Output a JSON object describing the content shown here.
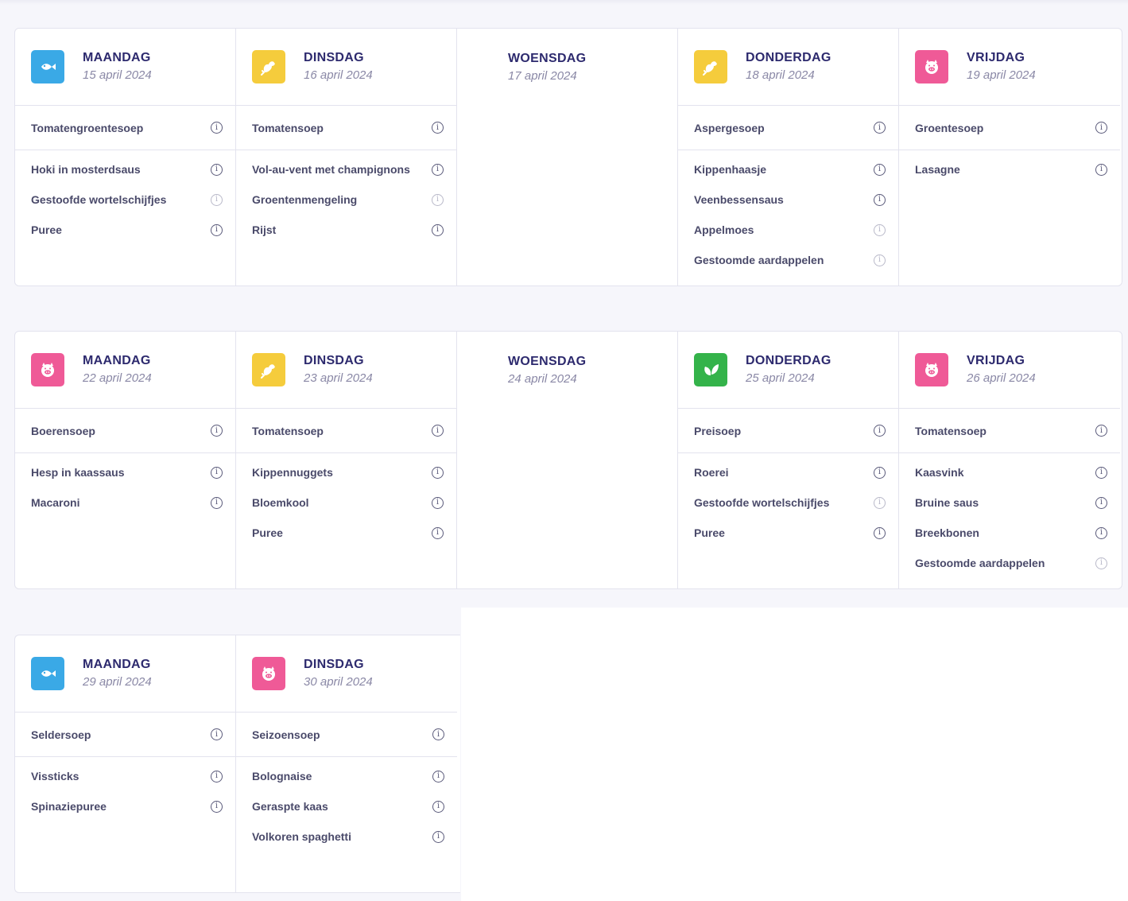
{
  "colors": {
    "fish": "#3aa9e6",
    "chicken": "#f5cc3c",
    "pork": "#ef5a97",
    "vegetarian": "#34b34a",
    "title": "#2d2a6e"
  },
  "weeks": [
    {
      "days": [
        {
          "name": "MAANDAG",
          "date": "15 april 2024",
          "icon": "fish-icon",
          "color": "#3aa9e6",
          "soup": "Tomatengroentesoep",
          "items": [
            "Hoki in mosterdsaus",
            "Gestoofde wortelschijfjes",
            "Puree"
          ]
        },
        {
          "name": "DINSDAG",
          "date": "16 april 2024",
          "icon": "chicken-icon",
          "color": "#f5cc3c",
          "soup": "Tomatensoep",
          "items": [
            "Vol-au-vent met champignons",
            "Groentenmengeling",
            "Rijst"
          ]
        },
        {
          "name": "WOENSDAG",
          "date": "17 april 2024",
          "icon": null,
          "color": null,
          "soup": null,
          "items": []
        },
        {
          "name": "DONDERDAG",
          "date": "18 april 2024",
          "icon": "chicken-icon",
          "color": "#f5cc3c",
          "soup": "Aspergesoep",
          "items": [
            "Kippenhaasje",
            "Veenbessensaus",
            "Appelmoes",
            "Gestoomde aardappelen"
          ]
        },
        {
          "name": "VRIJDAG",
          "date": "19 april 2024",
          "icon": "pig-icon",
          "color": "#ef5a97",
          "soup": "Groentesoep",
          "items": [
            "Lasagne"
          ]
        }
      ]
    },
    {
      "days": [
        {
          "name": "MAANDAG",
          "date": "22 april 2024",
          "icon": "pig-icon",
          "color": "#ef5a97",
          "soup": "Boerensoep",
          "items": [
            "Hesp in kaassaus",
            "Macaroni"
          ]
        },
        {
          "name": "DINSDAG",
          "date": "23 april 2024",
          "icon": "chicken-icon",
          "color": "#f5cc3c",
          "soup": "Tomatensoep",
          "items": [
            "Kippennuggets",
            "Bloemkool",
            "Puree"
          ]
        },
        {
          "name": "WOENSDAG",
          "date": "24 april 2024",
          "icon": null,
          "color": null,
          "soup": null,
          "items": []
        },
        {
          "name": "DONDERDAG",
          "date": "25 april 2024",
          "icon": "leaf-icon",
          "color": "#34b34a",
          "soup": "Preisoep",
          "items": [
            "Roerei",
            "Gestoofde wortelschijfjes",
            "Puree"
          ]
        },
        {
          "name": "VRIJDAG",
          "date": "26 april 2024",
          "icon": "pig-icon",
          "color": "#ef5a97",
          "soup": "Tomatensoep",
          "items": [
            "Kaasvink",
            "Bruine saus",
            "Breekbonen",
            "Gestoomde aardappelen"
          ]
        }
      ]
    },
    {
      "days": [
        {
          "name": "MAANDAG",
          "date": "29 april 2024",
          "icon": "fish-icon",
          "color": "#3aa9e6",
          "soup": "Seldersoep",
          "items": [
            "Vissticks",
            "Spinaziepuree"
          ]
        },
        {
          "name": "DINSDAG",
          "date": "30 april 2024",
          "icon": "pig-icon",
          "color": "#ef5a97",
          "soup": "Seizoensoep",
          "items": [
            "Bolognaise",
            "Geraspte kaas",
            "Volkoren spaghetti"
          ]
        }
      ]
    }
  ]
}
